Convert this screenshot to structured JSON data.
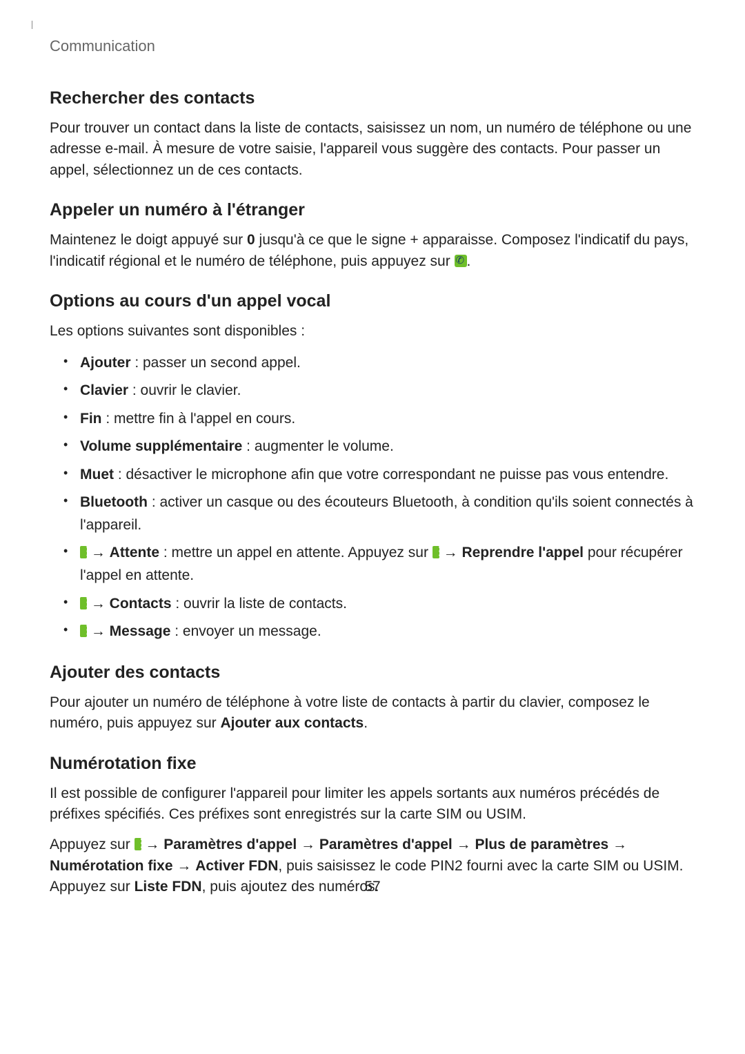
{
  "header": "Communication",
  "s1": {
    "title": "Rechercher des contacts",
    "p1": "Pour trouver un contact dans la liste de contacts, saisissez un nom, un numéro de téléphone ou une adresse e-mail. À mesure de votre saisie, l'appareil vous suggère des contacts. Pour passer un appel, sélectionnez un de ces contacts."
  },
  "s2": {
    "title": "Appeler un numéro à l'étranger",
    "p1a": "Maintenez le doigt appuyé sur ",
    "p1b": "0",
    "p1c": " jusqu'à ce que le signe + apparaisse. Composez l'indicatif du pays, l'indicatif régional et le numéro de téléphone, puis appuyez sur ",
    "p1d": "."
  },
  "s3": {
    "title": "Options au cours d'un appel vocal",
    "intro": "Les options suivantes sont disponibles :",
    "items": [
      {
        "b": "Ajouter",
        "t": " : passer un second appel."
      },
      {
        "b": "Clavier",
        "t": " : ouvrir le clavier."
      },
      {
        "b": "Fin",
        "t": " : mettre fin à l'appel en cours."
      },
      {
        "b": "Volume supplémentaire",
        "t": " : augmenter le volume."
      },
      {
        "b": "Muet",
        "t": " : désactiver le microphone afin que votre correspondant ne puisse pas vous entendre."
      },
      {
        "b": "Bluetooth",
        "t": " : activer un casque ou des écouteurs Bluetooth, à condition qu'ils soient connectés à l'appareil."
      }
    ],
    "hold": {
      "arrow1": " → ",
      "b1": "Attente",
      "t1": " : mettre un appel en attente. Appuyez sur ",
      "arrow2": " → ",
      "b2": "Reprendre l'appel",
      "t2": " pour récupérer l'appel en attente."
    },
    "contacts": {
      "arrow": " → ",
      "b": "Contacts",
      "t": " : ouvrir la liste de contacts."
    },
    "message": {
      "arrow": " → ",
      "b": "Message",
      "t": " : envoyer un message."
    }
  },
  "s4": {
    "title": "Ajouter des contacts",
    "p1a": "Pour ajouter un numéro de téléphone à votre liste de contacts à partir du clavier, composez le numéro, puis appuyez sur ",
    "p1b": "Ajouter aux contacts",
    "p1c": "."
  },
  "s5": {
    "title": "Numérotation fixe",
    "p1": "Il est possible de configurer l'appareil pour limiter les appels sortants aux numéros précédés de préfixes spécifiés. Ces préfixes sont enregistrés sur la carte SIM ou USIM.",
    "p2a": "Appuyez sur ",
    "arrow": " → ",
    "b1": "Paramètres d'appel",
    "b2": "Paramètres d'appel",
    "b3": "Plus de paramètres",
    "b4": "Numérotation fixe",
    "b5": "Activer FDN",
    "p2b": ", puis saisissez le code PIN2 fourni avec la carte SIM ou USIM. Appuyez sur ",
    "b6": "Liste FDN",
    "p2c": ", puis ajoutez des numéros."
  },
  "pageNumber": "57"
}
